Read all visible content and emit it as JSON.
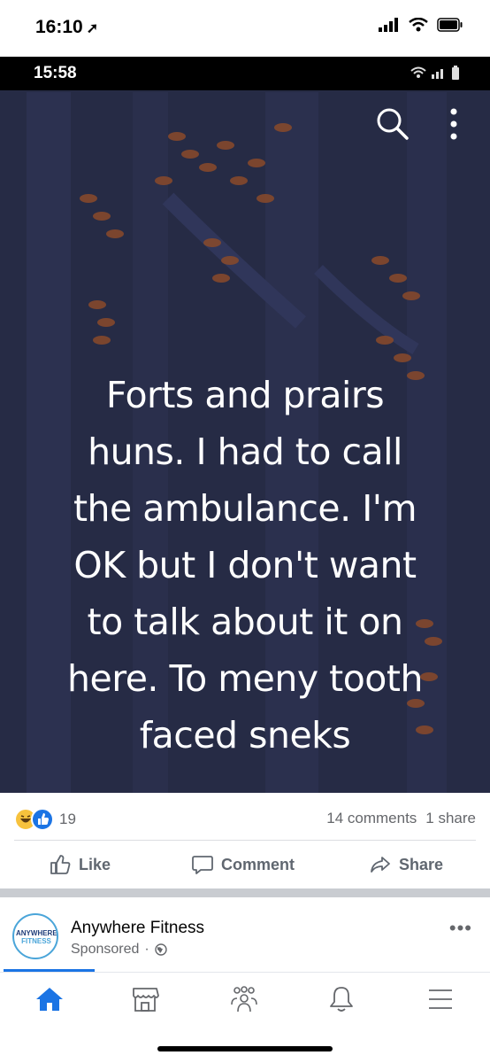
{
  "device_status": {
    "time": "16:10",
    "location_arrow": "location-arrow-icon"
  },
  "photo": {
    "status_time": "15:58",
    "text_lines": [
      "Forts and prairs",
      "huns. I had to call",
      "the ambulance. I'm",
      "OK but I don't want",
      "to talk about it on",
      "here. To meny tooth",
      "faced sneks"
    ],
    "background_color": "#262b45"
  },
  "reactions": {
    "count": "19",
    "icons": [
      "haha-icon",
      "like-icon"
    ]
  },
  "engagement": {
    "comments": "14 comments",
    "shares": "1 share"
  },
  "actions": {
    "like": "Like",
    "comment": "Comment",
    "share": "Share"
  },
  "ad": {
    "page_name": "Anywhere Fitness",
    "sponsored": "Sponsored",
    "logo_text_line1": "ANYWHERE",
    "logo_text_line2": "FITNESS",
    "more": "•••"
  },
  "tabs": [
    "home-icon",
    "marketplace-icon",
    "groups-icon",
    "notifications-icon",
    "menu-icon"
  ],
  "colors": {
    "accent": "#1b74e4",
    "muted_text": "#65676b"
  }
}
